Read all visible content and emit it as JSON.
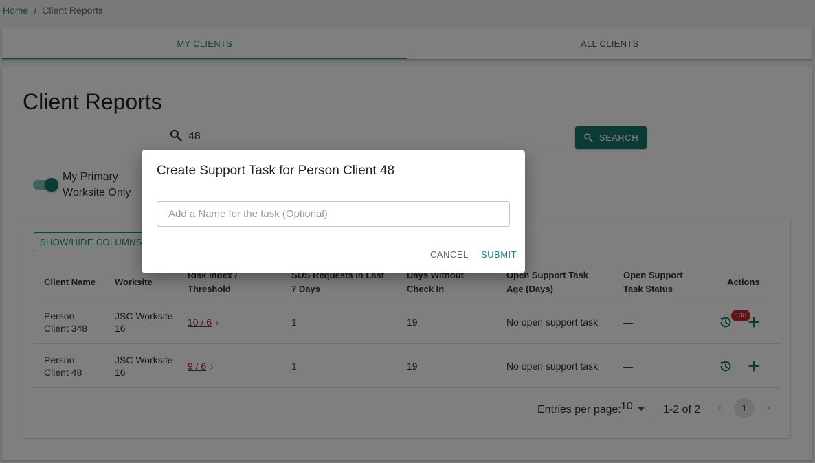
{
  "breadcrumb": {
    "home": "Home",
    "separator": "/",
    "current": "Client Reports"
  },
  "tabs": [
    {
      "label": "MY CLIENTS",
      "active": true
    },
    {
      "label": "ALL CLIENTS",
      "active": false
    }
  ],
  "page_title": "Client Reports",
  "search": {
    "value": "48",
    "button_label": "SEARCH",
    "icon": "search-icon"
  },
  "toggle": {
    "label": "My Primary Worksite Only",
    "checked": true
  },
  "table": {
    "show_hide_label": "SHOW/HIDE COLUMNS",
    "columns": [
      "Client Name",
      "Worksite",
      "Risk Index / Threshold",
      "SOS Requests in Last 7 Days",
      "Days Without Check In",
      "Open Support Task Age (Days)",
      "Open Support Task Status",
      "Actions"
    ],
    "rows": [
      {
        "client_name": "Person Client 348",
        "worksite": "JSC Worksite 16",
        "risk": "10 / 6",
        "sos": "1",
        "days_without_checkin": "19",
        "task_age": "No open support task",
        "task_status": "—",
        "badge": "138"
      },
      {
        "client_name": "Person Client 48",
        "worksite": "JSC Worksite 16",
        "risk": "9 / 6",
        "sos": "1",
        "days_without_checkin": "19",
        "task_age": "No open support task",
        "task_status": "—",
        "badge": ""
      }
    ]
  },
  "pagination": {
    "entries_label": "Entries per page:",
    "entries_value": "10",
    "range": "1-2 of 2",
    "current_page": "1"
  },
  "dialog": {
    "title": "Create Support Task for Person Client 48",
    "input_placeholder": "Add a Name for the task (Optional)",
    "input_value": "",
    "cancel_label": "CANCEL",
    "submit_label": "SUBMIT"
  },
  "colors": {
    "primary": "#16776c",
    "accent": "#1b8a7d",
    "danger": "#b3261e"
  }
}
